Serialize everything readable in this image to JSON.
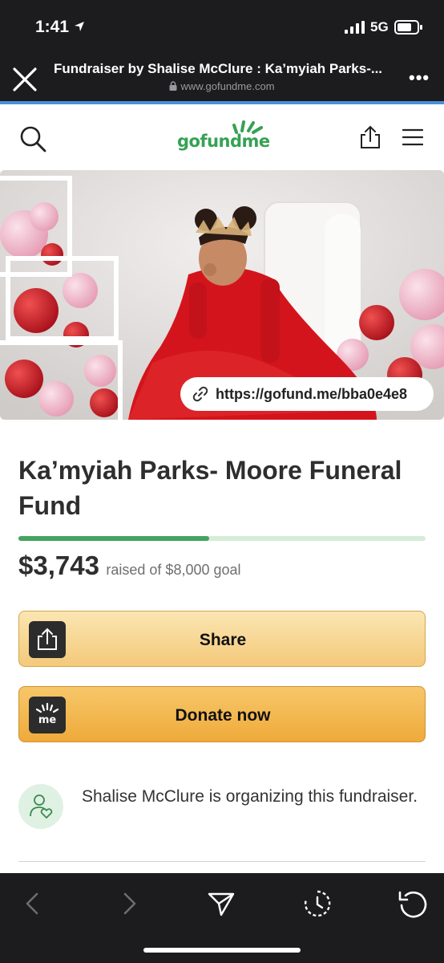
{
  "status": {
    "time": "1:41",
    "network": "5G"
  },
  "browser": {
    "title": "Fundraiser by Shalise McClure : Ka’myiah Parks-...",
    "url": "www.gofundme.com",
    "close_icon": "close-icon",
    "more_label": "•••"
  },
  "site": {
    "logo_text": "gofundme",
    "brand_color": "#35a254"
  },
  "hero": {
    "short_link": "https://gofund.me/bba0e4e8"
  },
  "campaign": {
    "title": "Ka’myiah Parks- Moore Funeral Fund",
    "raised": "$3,743",
    "goal_text": "raised of $8,000 goal",
    "progress_fraction": 0.468
  },
  "actions": {
    "share_label": "Share",
    "donate_label": "Donate now"
  },
  "organizer": {
    "text": "Shalise McClure is organizing this fundraiser."
  },
  "toolbar": {
    "icons": [
      "back-icon",
      "forward-icon",
      "send-icon",
      "history-icon",
      "reload-icon"
    ]
  }
}
